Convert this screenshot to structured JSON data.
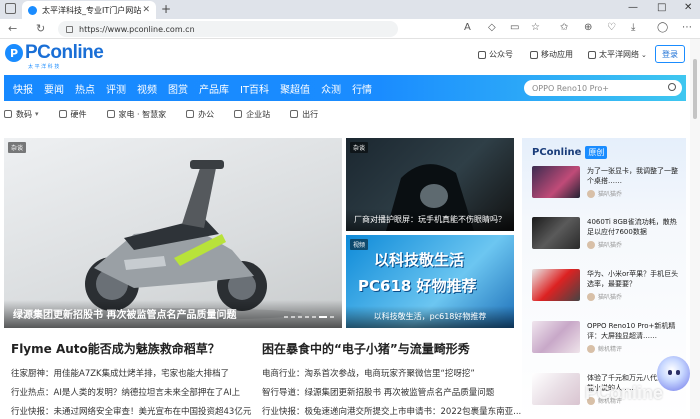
{
  "browser": {
    "tab_title": "太平洋科技_专业IT门户网站",
    "tab_close": "✕",
    "new_tab": "+",
    "url": "https://www.pconline.com.cn",
    "window_controls": [
      "—",
      "□",
      "✕"
    ]
  },
  "site": {
    "logo_text": "PConline",
    "logo_sub": "太 平 洋 科 技",
    "header_links": [
      "公众号",
      "移动应用",
      "太平洋网络"
    ],
    "login": "登录",
    "nav": [
      "快报",
      "要闻",
      "热点",
      "评测",
      "视频",
      "图赏",
      "产品库",
      "IT百科",
      "聚超值",
      "众测",
      "行情"
    ],
    "search_placeholder": "OPPO Reno10 Pro+",
    "subnav": [
      "数码",
      "硬件",
      "家电 · 智慧家",
      "办公",
      "企业站",
      "出行"
    ]
  },
  "hero": {
    "tag": "杂谈",
    "title": "绿源集团更新招股书 再次被监管点名产品质量问题"
  },
  "cards": [
    {
      "tag": "杂谈",
      "title": "厂商对播护眼屏：玩手机真能不伤眼睛吗？"
    },
    {
      "tag": "视频",
      "title": "以科技敬生活，pc618好物推荐",
      "overlay": "以科技敬生活",
      "overlay2": "PC618 好物推荐"
    }
  ],
  "headlines": {
    "left": {
      "title": "Flyme Auto能否成为魅族救命稻草？",
      "items": [
        {
          "cat": "往家厨神：",
          "text": "用佳能A7ZK集成灶烤羊排，宅家也能大排档了"
        },
        {
          "cat": "行业热点：",
          "text": "AI是人类的发明？纳德拉坦言未来全部押在了AI上"
        },
        {
          "cat": "行业快报：",
          "text": "未通过网络安全审查！美光宣布在中国投资超43亿元"
        }
      ]
    },
    "right": {
      "title": "困在暴食中的“电子小猪”与流量畸形秀",
      "items": [
        {
          "cat": "电商行业：",
          "text": "淘系首次参战，电商玩家齐聚微信里“挖呀挖”"
        },
        {
          "cat": "智行导道：",
          "text": "绿源集团更新招股书 再次被监管点名产品质量问题"
        },
        {
          "cat": "行业快报：",
          "text": "极兔速递向港交所提交上市申请书：2022包裹量东南亚..."
        }
      ]
    }
  },
  "sidebar": {
    "brand": "PConline",
    "badge": "原创",
    "items": [
      {
        "title": "为了一张显卡，我调整了一整个桌搭……",
        "author": "猫叭猫乔"
      },
      {
        "title": "4060Ti 8GB雀流功耗，散热足以应付7600数据",
        "author": "猫叭猫乔"
      },
      {
        "title": "华为、小米or苹果？手机巨头选率，最要要？",
        "author": "猫叭猫乔"
      },
      {
        "title": "OPPO Reno10 Pro+新机精评：大屏独显超清……",
        "author": "鲸机精评"
      },
      {
        "title": "体验了千元和万元八代人工智能小说的人……",
        "author": "鲸机精评"
      }
    ]
  },
  "watermark": "PConline"
}
